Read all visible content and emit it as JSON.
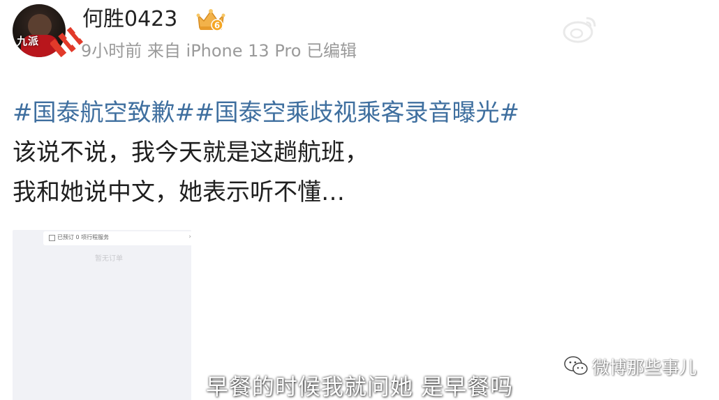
{
  "header": {
    "avatar_text": "九派",
    "username": "何胜0423",
    "badge_level": "6",
    "meta": "9小时前 来自 iPhone 13 Pro 已编辑"
  },
  "post": {
    "hashtags": [
      "#国泰航空致歉#",
      "#国泰空乘歧视乘客录音曝光#"
    ],
    "lines": [
      "该说不说，我今天就是这趟航班，",
      "我和她说中文，她表示听不懂…"
    ]
  },
  "embed": {
    "row_label": "已预订 0 项行程服务",
    "chevron": "›",
    "faded_text": "暂无订单"
  },
  "watermark_bottom": "微博那些事儿",
  "subtitle": "早餐的时候我就问她 是早餐吗",
  "colors": {
    "hashtag": "#3f6f9f",
    "text": "#1f1f1f",
    "meta": "#9a9a9a"
  },
  "icons": [
    "avatar",
    "jiupai-logo-icon",
    "level-crown-badge-icon",
    "weibo-watermark-icon",
    "wechat-icon",
    "order-icon",
    "chevron-right-icon"
  ]
}
